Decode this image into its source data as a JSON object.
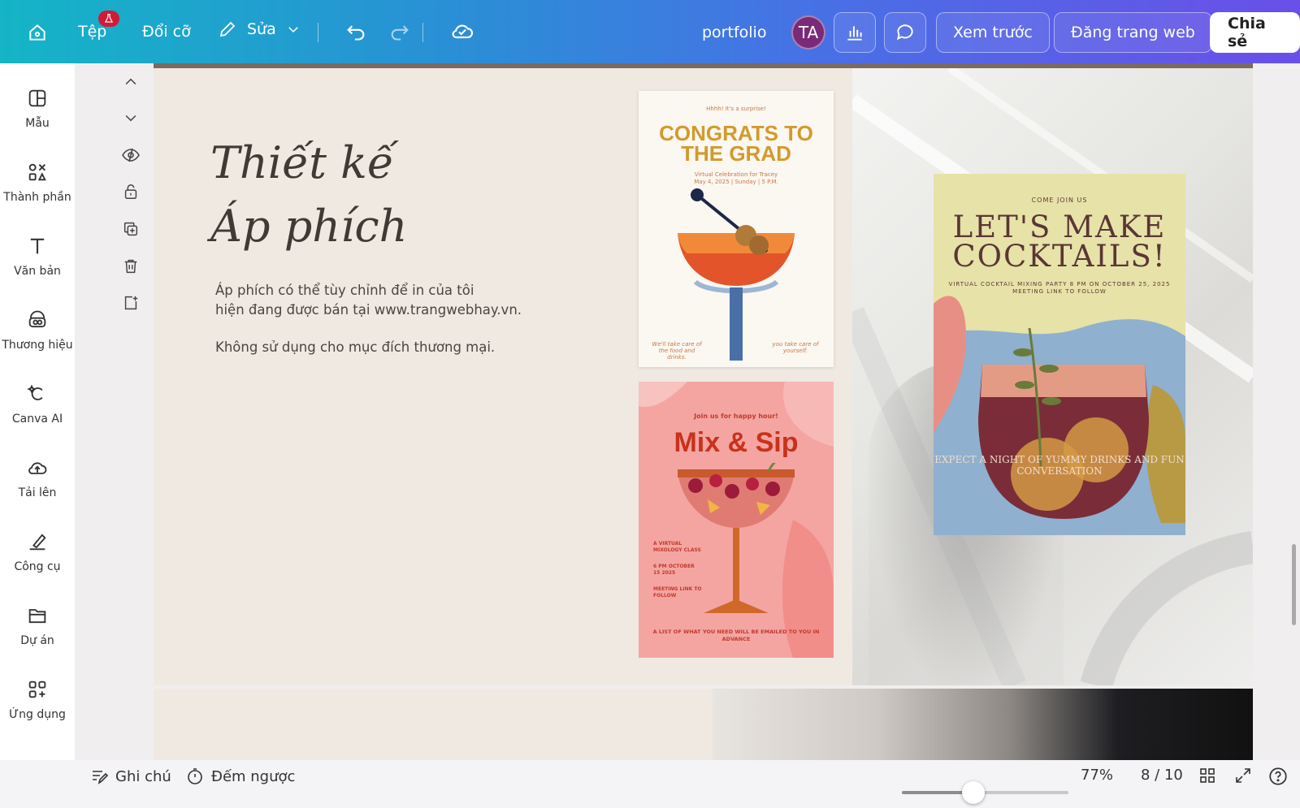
{
  "topbar": {
    "file_label": "Tệp",
    "resize_label": "Đổi cỡ",
    "edit_label": "Sửa",
    "title": "portfolio",
    "avatar_initials": "TA",
    "preview_label": "Xem trước",
    "publish_label": "Đăng trang web",
    "share_label": "Chia sẻ"
  },
  "sidebar": {
    "items": [
      {
        "label": "Mẫu",
        "icon": "template-icon"
      },
      {
        "label": "Thành phần",
        "icon": "elements-icon"
      },
      {
        "label": "Văn bản",
        "icon": "text-icon"
      },
      {
        "label": "Thương hiệu",
        "icon": "brand-icon"
      },
      {
        "label": "Canva AI",
        "icon": "canva-ai-icon"
      },
      {
        "label": "Tải lên",
        "icon": "upload-icon"
      },
      {
        "label": "Công cụ",
        "icon": "tools-icon"
      },
      {
        "label": "Dự án",
        "icon": "folder-icon"
      },
      {
        "label": "Ứng dụng",
        "icon": "apps-icon"
      }
    ]
  },
  "page": {
    "heading_line1": "Thiết kế",
    "heading_line2": "Áp phích",
    "body_line1": "Áp phích có thể tùy chỉnh để in của tôi",
    "body_line2": "hiện đang được bán tại www.trangwebhay.vn.",
    "body_line3": "Không sử dụng cho mục đích thương mại."
  },
  "posters": {
    "p1_small": "Hhhh! It's a surprise!",
    "p1_title": "CONGRATS TO THE GRAD",
    "p1_sub1": "Virtual Celebration for Tracey",
    "p1_sub2": "May 4, 2025 | Sunday | 5 P.M.",
    "p1_foot_left": "We'll take care of the food and drinks.",
    "p1_foot_right": "you take care of yourself.",
    "p2_top": "Join us for happy hour!",
    "p2_title": "Mix & Sip",
    "p2_side1": "A VIRTUAL MIXOLOGY CLASS",
    "p2_side2": "6 PM OCTOBER 15 2025",
    "p2_side3": "MEETING LINK TO FOLLOW",
    "p2_foot": "A LIST OF WHAT YOU NEED WILL BE EMAILED TO YOU IN ADVANCE",
    "p3_small": "COME JOIN US",
    "p3_title": "LET'S MAKE COCKTAILS!",
    "p3_sub": "VIRTUAL COCKTAIL MIXING PARTY 8 PM ON OCTOBER 25, 2025 MEETING LINK TO FOLLOW",
    "p3_foot": "EXPECT A NIGHT OF YUMMY DRINKS AND FUN CONVERSATION"
  },
  "bottombar": {
    "notes_label": "Ghi chú",
    "timer_label": "Đếm ngược",
    "zoom": "77%",
    "zoom_value": 0.77,
    "page_indicator": "8 / 10"
  },
  "colors": {
    "accent_start": "#14b5c6",
    "accent_end": "#6a4fe8",
    "badge": "#d11a3a"
  }
}
